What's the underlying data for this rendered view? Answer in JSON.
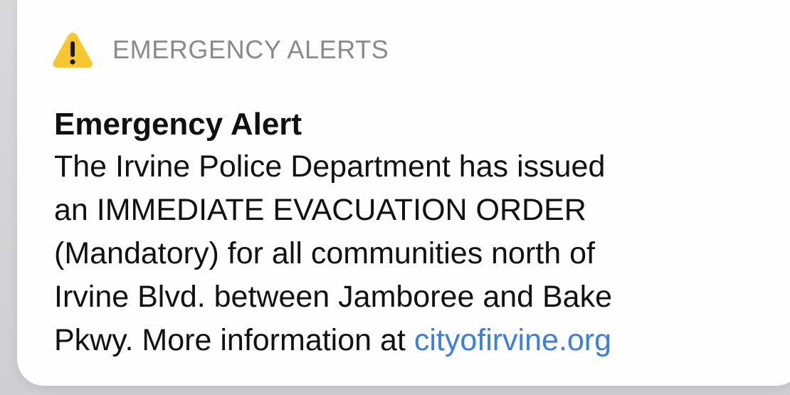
{
  "notification": {
    "app_name": "EMERGENCY ALERTS",
    "icon": "warning-triangle-icon",
    "icon_color": "#f7c631",
    "title": "Emergency Alert",
    "body_lines": [
      "The Irvine Police Department has issued",
      "an IMMEDIATE EVACUATION ORDER",
      "(Mandatory) for all communities north of",
      "Irvine Blvd. between Jamboree and Bake"
    ],
    "last_line_text": "Pkwy. More information at ",
    "link_text": "cityofirvine.org",
    "link_color": "#3a7ee0"
  }
}
